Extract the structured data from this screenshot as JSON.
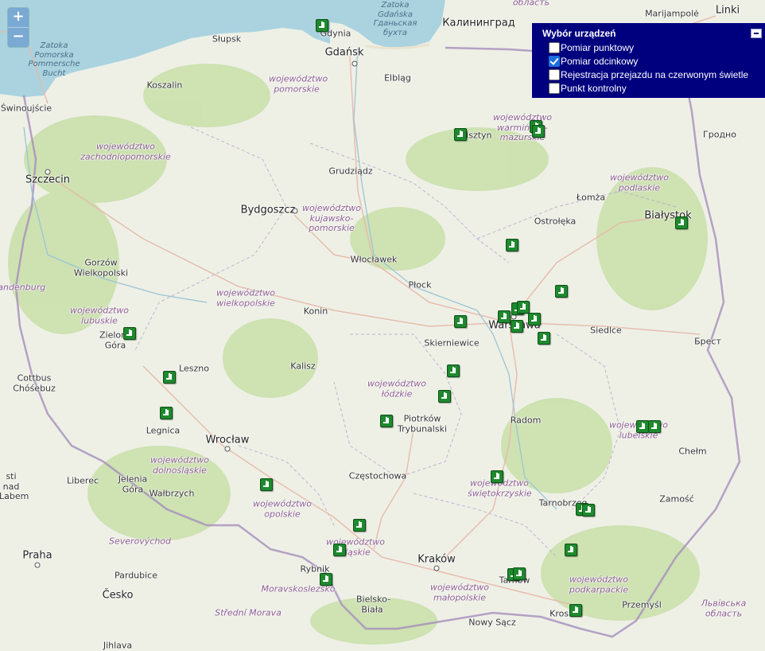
{
  "zoom": {
    "in_label": "+",
    "out_label": "−"
  },
  "panel": {
    "title": "Wybór urządzeń",
    "items": [
      {
        "label": "Pomiar punktowy",
        "checked": false
      },
      {
        "label": "Pomiar odcinkowy",
        "checked": true
      },
      {
        "label": "Rejestracja przejazdu na czerwonym świetle",
        "checked": false
      },
      {
        "label": "Punkt kontrolny",
        "checked": false
      }
    ]
  },
  "colors": {
    "panel_bg": "#00007f",
    "marker_green": "#1e8a2e",
    "sea": "#aad3df"
  },
  "map_labels": {
    "marijampole": "Marijampolė",
    "linki": "Linki",
    "oblast": "область",
    "kaliningrad": "Калининград",
    "zatoka_gdanska": "Zatoka Gdańska Гданьская бухта",
    "zatoka_pomorska": "Zatoka Pomorska Pommersche Bucht",
    "gdynia": "Gdynia",
    "slupsk": "Słupsk",
    "gdansk": "Gdańsk",
    "elblag": "Elbląg",
    "koszalin": "Koszalin",
    "swinoujscie": "Świnoujście",
    "olsztyn": "Olsztyn",
    "grodno": "Гродно",
    "szczecin": "Szczecin",
    "grudziadz": "Grudziądz",
    "lomza": "Łomża",
    "bydgoszcz": "Bydgoszcz",
    "ostroleka": "Ostrołęka",
    "bialystok": "Białystok",
    "gorzow": "Gorzów Wielkopolski",
    "wloclawek": "Włocławek",
    "brandenburg": "randenburg",
    "plock": "Płock",
    "konin": "Konin",
    "warszawa": "Warszawa",
    "siedlce": "Siedlce",
    "zielona_gora": "Zielona Góra",
    "brest": "Брест",
    "skierniewice": "Skierniewice",
    "cottbus": "Cottbus Chóśebuz",
    "leszno": "Leszno",
    "kalisz": "Kalisz",
    "radom": "Radom",
    "piotrkow": "Piotrków Trybunalski",
    "legnica": "Legnica",
    "wroclaw": "Wrocław",
    "chelm": "Chełm",
    "czestochowa": "Częstochowa",
    "liberec": "Liberec",
    "jelenia_gora": "Jelenia Góra",
    "usti": "sti nad Labem",
    "walbrzych": "Wałbrzych",
    "tarnobrzeg": "Tarnobrzeg",
    "zamosc": "Zamość",
    "praha": "Praha",
    "krakow": "Kraków",
    "severovychod": "Severovýchod",
    "pardubice": "Pardubice",
    "rybnik": "Rybnik",
    "tarnow": "Tarnów",
    "cesko": "Česko",
    "moravskoslezsko": "Moravskoslezsko",
    "bielsko": "Bielsko-Biała",
    "przemysl": "Przemyśl",
    "lviv": "Львівська область",
    "stredni_morava": "Střední Morava",
    "krosno": "Krosno",
    "nowy_sacz": "Nowy Sącz",
    "jihlava": "Jihlava",
    "oblast_left": "nad"
  },
  "regions": {
    "pomorskie": "województwo pomorskie",
    "warminsko": "województwo warmińsko-mazurskie",
    "zachodniopomorskie": "województwo zachodniopomorskie",
    "kujawsko": "województwo kujawsko-pomorskie",
    "podlaskie": "województwo podlaskie",
    "wielkopolskie": "województwo wielkopolskie",
    "lubuskie": "województwo lubuskie",
    "lodzkie": "województwo łódzkie",
    "lubelskie": "województwo lubelskie",
    "dolnoslaskie": "województwo dolnośląskie",
    "swietokrzyskie": "województwo świętokrzyskie",
    "opolskie": "województwo opolskie",
    "slaskie": "województwo śląskie",
    "malopolskie": "województwo małopolskie",
    "podkarpackie": "województwo podkarpackie"
  }
}
